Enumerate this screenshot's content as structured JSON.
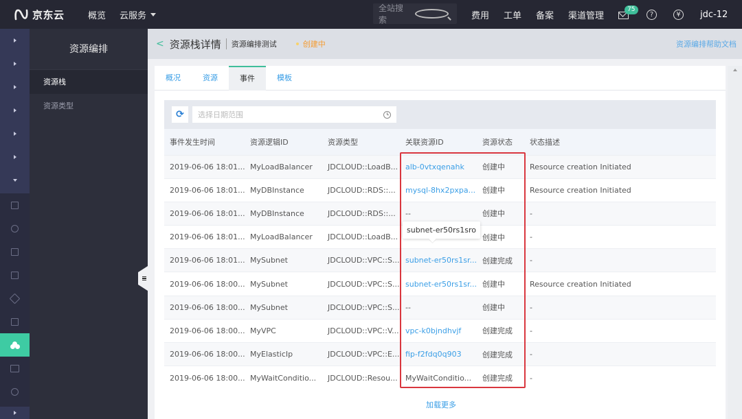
{
  "topnav": {
    "brand": "京东云",
    "links": [
      "概览",
      "云服务"
    ],
    "search_placeholder": "全站搜索",
    "right_links": [
      "费用",
      "工单",
      "备案",
      "渠道管理"
    ],
    "mail_badge": "75",
    "help_icon": "?",
    "user": "jdc-12"
  },
  "subnav": {
    "title": "资源编排",
    "items": [
      {
        "label": "资源栈",
        "active": true
      },
      {
        "label": "资源类型",
        "active": false
      }
    ]
  },
  "header": {
    "back": "<",
    "title": "资源栈详情",
    "stack_name": "资源编排测试",
    "status": "创建中",
    "help_link": "资源编排帮助文档"
  },
  "tabs": [
    {
      "label": "概况",
      "active": false
    },
    {
      "label": "资源",
      "active": false
    },
    {
      "label": "事件",
      "active": true
    },
    {
      "label": "模板",
      "active": false
    }
  ],
  "filter": {
    "refresh_icon": "⟳",
    "date_placeholder": "选择日期范围"
  },
  "table": {
    "columns": [
      "事件发生时间",
      "资源逻辑ID",
      "资源类型",
      "关联资源ID",
      "资源状态",
      "状态描述"
    ],
    "rows": [
      {
        "time": "2019-06-06 18:01...",
        "logical_id": "MyLoadBalancer",
        "type": "JDCLOUD::LoadB...",
        "resource_id": "alb-0vtxqenahk",
        "status": "创建中",
        "desc": "Resource creation Initiated"
      },
      {
        "time": "2019-06-06 18:01...",
        "logical_id": "MyDBInstance",
        "type": "JDCLOUD::RDS::...",
        "resource_id": "mysql-8hx2pxpa...",
        "status": "创建中",
        "desc": "Resource creation Initiated"
      },
      {
        "time": "2019-06-06 18:01...",
        "logical_id": "MyDBInstance",
        "type": "JDCLOUD::RDS::...",
        "resource_id": "--",
        "status": "创建中",
        "desc": "-"
      },
      {
        "time": "2019-06-06 18:01...",
        "logical_id": "MyLoadBalancer",
        "type": "JDCLOUD::LoadB...",
        "resource_id": "--",
        "status": "创建中",
        "desc": "-"
      },
      {
        "time": "2019-06-06 18:01...",
        "logical_id": "MySubnet",
        "type": "JDCLOUD::VPC::S...",
        "resource_id": "subnet-er50rs1sr...",
        "status": "创建完成",
        "desc": "-"
      },
      {
        "time": "2019-06-06 18:00...",
        "logical_id": "MySubnet",
        "type": "JDCLOUD::VPC::S...",
        "resource_id": "subnet-er50rs1sr...",
        "status": "创建中",
        "desc": "Resource creation Initiated"
      },
      {
        "time": "2019-06-06 18:00...",
        "logical_id": "MySubnet",
        "type": "JDCLOUD::VPC::S...",
        "resource_id": "--",
        "status": "创建中",
        "desc": "-"
      },
      {
        "time": "2019-06-06 18:00...",
        "logical_id": "MyVPC",
        "type": "JDCLOUD::VPC::V...",
        "resource_id": "vpc-k0bjndhvjf",
        "status": "创建完成",
        "desc": "-"
      },
      {
        "time": "2019-06-06 18:00...",
        "logical_id": "MyElasticIp",
        "type": "JDCLOUD::VPC::E...",
        "resource_id": "fip-f2fdq0q903",
        "status": "创建完成",
        "desc": "-"
      },
      {
        "time": "2019-06-06 18:00...",
        "logical_id": "MyWaitConditio...",
        "type": "JDCLOUD::Resou...",
        "resource_id": "MyWaitConditio...",
        "status": "创建完成",
        "desc": "-"
      }
    ],
    "link_rows": [
      0,
      1,
      4,
      5,
      7,
      8
    ]
  },
  "tooltip": "subnet-er50rs1sro",
  "load_more": "加载更多",
  "colors": {
    "accent": "#3ebe9a",
    "link": "#3a9ee6",
    "status_orange": "#f59b30",
    "highlight": "#d9363e"
  }
}
